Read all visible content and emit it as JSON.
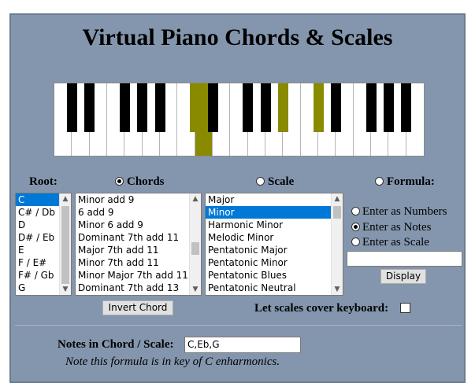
{
  "title": "Virtual Piano Chords & Scales",
  "highlight_color": "#8a8a00",
  "piano": {
    "white_keys": 21,
    "highlighted_white": [
      8
    ],
    "black_pattern": [
      1,
      1,
      0,
      1,
      1,
      1,
      0,
      1,
      1,
      0,
      1,
      1,
      1,
      0,
      1,
      1,
      0,
      1,
      1,
      1
    ],
    "highlighted_black": [
      5,
      9,
      10
    ]
  },
  "labels": {
    "root": "Root:",
    "chords": "Chords",
    "scale": "Scale",
    "formula": "Formula:",
    "enter_numbers": "Enter as Numbers",
    "enter_notes": "Enter as Notes",
    "enter_scale": "Enter as Scale",
    "cover_keyboard": "Let scales cover keyboard:",
    "notes_in": "Notes in Chord / Scale:",
    "note": "Note this formula is in key of C enharmonics."
  },
  "root_list": [
    "C",
    "C# / Db",
    "D",
    "D# / Eb",
    "E",
    "F / E#",
    "F# / Gb",
    "G"
  ],
  "root_selected": 0,
  "chord_list": [
    "Minor add 9",
    "6 add 9",
    "Minor 6 add 9",
    "Dominant 7th add 11",
    "Major 7th add 11",
    "Minor 7th add 11",
    "Minor Major 7th add 11",
    "Dominant 7th add 13"
  ],
  "scale_list": [
    "Major",
    "Minor",
    "Harmonic Minor",
    "Melodic Minor",
    "Pentatonic Major",
    "Pentatonic Minor",
    "Pentatonic Blues",
    "Pentatonic Neutral"
  ],
  "scale_selected": 1,
  "buttons": {
    "invert": "Invert Chord",
    "display": "Display"
  },
  "notes_value": "C,Eb,G",
  "formula_value": ""
}
